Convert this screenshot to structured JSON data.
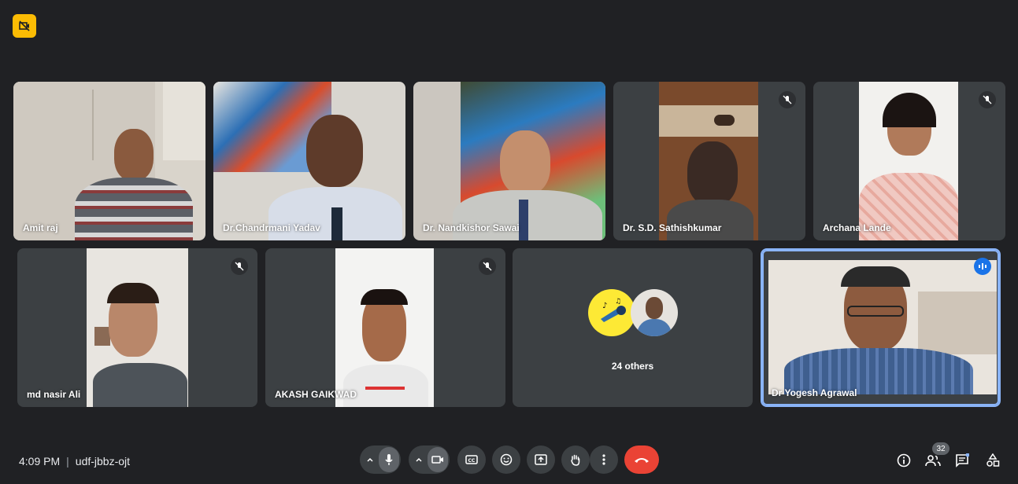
{
  "colors": {
    "background": "#202124",
    "tile": "#3c4043",
    "accent": "#1a73e8",
    "end_call": "#ea4335",
    "badge": "#fbbc04"
  },
  "top_badge_icon": "camera-off-icon",
  "participants": [
    {
      "name": "Amit raj",
      "muted": false
    },
    {
      "name": "Dr.Chandrmani Yadav",
      "muted": false
    },
    {
      "name": "Dr. Nandkishor Sawai",
      "muted": false
    },
    {
      "name": "Dr. S.D. Sathishkumar",
      "muted": true
    },
    {
      "name": "Archana Lande",
      "muted": true
    },
    {
      "name": "md nasir Ali",
      "muted": true
    },
    {
      "name": "AKASH GAIKWAD",
      "muted": true
    },
    {
      "name": "Dr Yogesh Agrawal",
      "muted": false,
      "speaking": true
    }
  ],
  "others_tile": {
    "label": "24 others"
  },
  "meeting": {
    "time": "4:09 PM",
    "separator": "|",
    "code": "udf-jbbz-ojt"
  },
  "controls": [
    "mic-options",
    "mic",
    "camera-options",
    "camera",
    "captions",
    "emoji",
    "present",
    "raise-hand",
    "more-options",
    "end-call"
  ],
  "right_controls": {
    "people_count": "32",
    "icons": [
      "info-icon",
      "people-icon",
      "chat-icon",
      "activities-icon"
    ]
  }
}
